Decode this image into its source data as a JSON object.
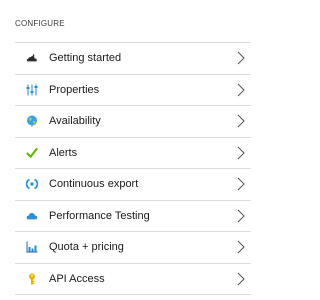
{
  "section": {
    "title": "CONFIGURE"
  },
  "menu": {
    "items": [
      {
        "label": "Getting started",
        "icon": "cloud-rocket-icon"
      },
      {
        "label": "Properties",
        "icon": "sliders-icon"
      },
      {
        "label": "Availability",
        "icon": "globe-icon"
      },
      {
        "label": "Alerts",
        "icon": "checkmark-icon"
      },
      {
        "label": "Continuous export",
        "icon": "export-icon"
      },
      {
        "label": "Performance Testing",
        "icon": "cloud-icon"
      },
      {
        "label": "Quota + pricing",
        "icon": "bar-chart-icon"
      },
      {
        "label": "API Access",
        "icon": "key-icon"
      }
    ]
  },
  "colors": {
    "divider": "#dcdcdc",
    "check_green": "#5db300",
    "accent_blue": "#1e8fd8",
    "key_yellow": "#e8b400",
    "dark_icon": "#2b2b2b"
  }
}
